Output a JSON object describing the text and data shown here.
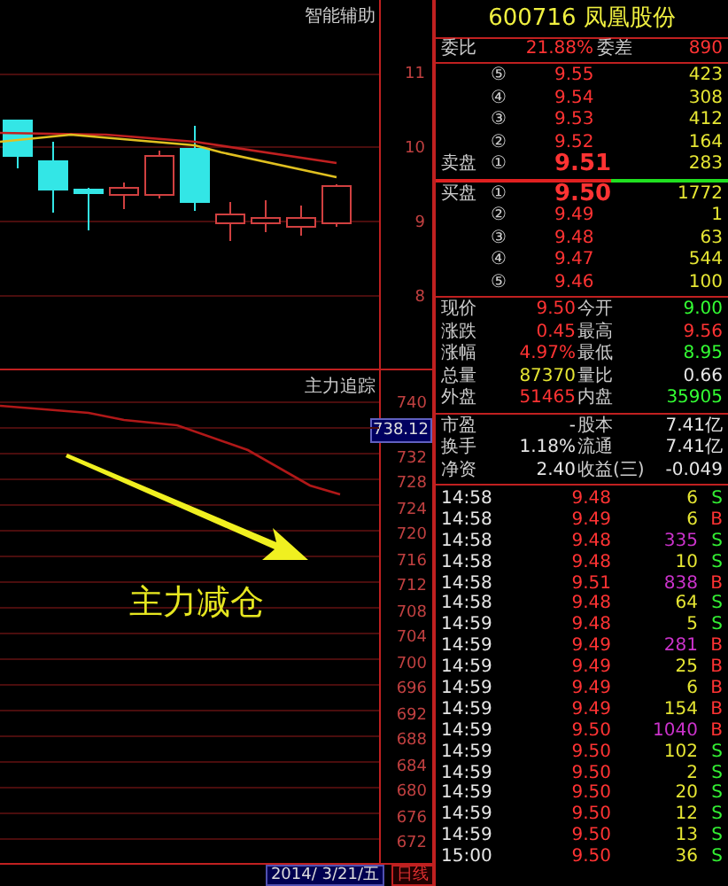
{
  "top_chart": {
    "title": "智能辅助",
    "axis_labels": [
      "11",
      "10",
      "9",
      "8"
    ]
  },
  "bottom_chart": {
    "title": "主力追踪",
    "axis_labels": [
      "740",
      "732",
      "728",
      "724",
      "720",
      "716",
      "712",
      "708",
      "704",
      "700",
      "696",
      "692",
      "688",
      "684",
      "680",
      "676",
      "672"
    ],
    "current_value": "738.12",
    "annotation": "主力减仓"
  },
  "date_bar": {
    "date": "2014/ 3/21/五",
    "period": "日线"
  },
  "quote": {
    "title": "600716 凤凰股份",
    "ratio": {
      "label": "委比",
      "value": "21.88%",
      "diff_label": "委差",
      "diff": "890"
    },
    "asks": [
      {
        "level": "⑤",
        "price": "9.55",
        "volume": "423"
      },
      {
        "level": "④",
        "price": "9.54",
        "volume": "308"
      },
      {
        "level": "③",
        "price": "9.53",
        "volume": "412"
      },
      {
        "level": "②",
        "price": "9.52",
        "volume": "164"
      },
      {
        "label": "卖盘",
        "level": "①",
        "price": "9.51",
        "volume": "283"
      }
    ],
    "bids": [
      {
        "label": "买盘",
        "level": "①",
        "price": "9.50",
        "volume": "1772"
      },
      {
        "level": "②",
        "price": "9.49",
        "volume": "1"
      },
      {
        "level": "③",
        "price": "9.48",
        "volume": "63"
      },
      {
        "level": "④",
        "price": "9.47",
        "volume": "544"
      },
      {
        "level": "⑤",
        "price": "9.46",
        "volume": "100"
      }
    ],
    "stats": [
      [
        {
          "label": "现价",
          "value": "9.50",
          "color": "#ff3333"
        },
        {
          "label": "今开",
          "value": "9.00",
          "color": "#33ff33"
        }
      ],
      [
        {
          "label": "涨跌",
          "value": "0.45",
          "color": "#ff3333"
        },
        {
          "label": "最高",
          "value": "9.56",
          "color": "#ff3333"
        }
      ],
      [
        {
          "label": "涨幅",
          "value": "4.97%",
          "color": "#ff3333"
        },
        {
          "label": "最低",
          "value": "8.95",
          "color": "#33ff33"
        }
      ],
      [
        {
          "label": "总量",
          "value": "87370",
          "color": "#e6e633"
        },
        {
          "label": "量比",
          "value": "0.66",
          "color": "#e6e6e6"
        }
      ],
      [
        {
          "label": "外盘",
          "value": "51465",
          "color": "#ff3333"
        },
        {
          "label": "内盘",
          "value": "35905",
          "color": "#33ff33"
        }
      ]
    ],
    "info": [
      {
        "label": "市盈",
        "value": "-",
        "label2": "股本",
        "value2": "7.41亿"
      },
      {
        "label": "换手",
        "value": "1.18%",
        "label2": "流通",
        "value2": "7.41亿"
      },
      {
        "label": "净资",
        "value": "2.40",
        "label2": "收益(三)",
        "value2": "-0.049"
      }
    ]
  },
  "ticks": [
    {
      "time": "14:58",
      "price": "9.48",
      "volume": "6",
      "large": false,
      "side": "S",
      "buy": false
    },
    {
      "time": "14:58",
      "price": "9.49",
      "volume": "6",
      "large": false,
      "side": "B",
      "buy": true
    },
    {
      "time": "14:58",
      "price": "9.48",
      "volume": "335",
      "large": true,
      "side": "S",
      "buy": false
    },
    {
      "time": "14:58",
      "price": "9.48",
      "volume": "10",
      "large": false,
      "side": "S",
      "buy": false
    },
    {
      "time": "14:58",
      "price": "9.51",
      "volume": "838",
      "large": true,
      "side": "B",
      "buy": true
    },
    {
      "time": "14:58",
      "price": "9.48",
      "volume": "64",
      "large": false,
      "side": "S",
      "buy": false
    },
    {
      "time": "14:59",
      "price": "9.48",
      "volume": "5",
      "large": false,
      "side": "S",
      "buy": false
    },
    {
      "time": "14:59",
      "price": "9.49",
      "volume": "281",
      "large": true,
      "side": "B",
      "buy": true
    },
    {
      "time": "14:59",
      "price": "9.49",
      "volume": "25",
      "large": false,
      "side": "B",
      "buy": true
    },
    {
      "time": "14:59",
      "price": "9.49",
      "volume": "6",
      "large": false,
      "side": "B",
      "buy": true
    },
    {
      "time": "14:59",
      "price": "9.49",
      "volume": "154",
      "large": false,
      "side": "B",
      "buy": true
    },
    {
      "time": "14:59",
      "price": "9.50",
      "volume": "1040",
      "large": true,
      "side": "B",
      "buy": true
    },
    {
      "time": "14:59",
      "price": "9.50",
      "volume": "102",
      "large": false,
      "side": "S",
      "buy": false
    },
    {
      "time": "14:59",
      "price": "9.50",
      "volume": "2",
      "large": false,
      "side": "S",
      "buy": false
    },
    {
      "time": "14:59",
      "price": "9.50",
      "volume": "20",
      "large": false,
      "side": "S",
      "buy": false
    },
    {
      "time": "14:59",
      "price": "9.50",
      "volume": "12",
      "large": false,
      "side": "S",
      "buy": false
    },
    {
      "time": "14:59",
      "price": "9.50",
      "volume": "13",
      "large": false,
      "side": "S",
      "buy": false
    },
    {
      "time": "15:00",
      "price": "9.50",
      "volume": "36",
      "large": false,
      "side": "S",
      "buy": false
    }
  ]
}
